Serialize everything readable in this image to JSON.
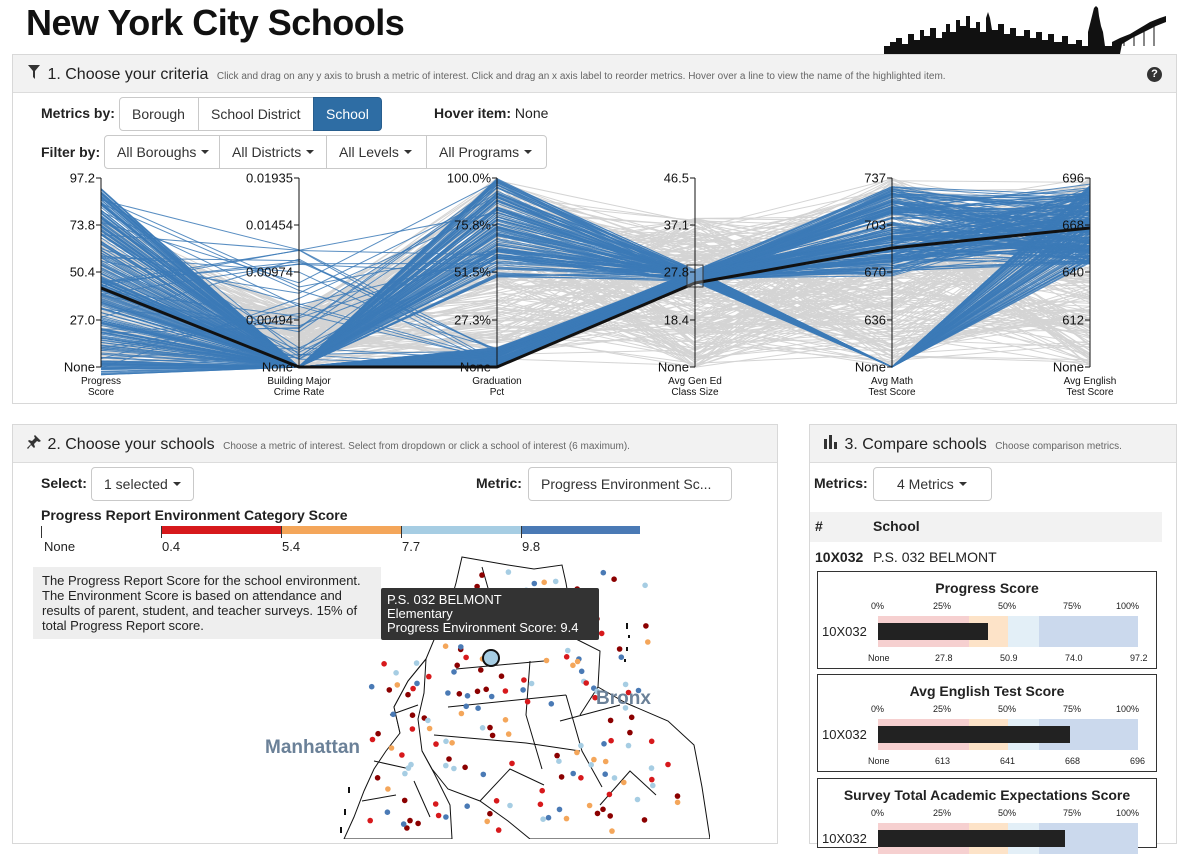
{
  "page_title": "New York City Schools",
  "criteria": {
    "number_title": "1. Choose your criteria",
    "subtitle": "Click and drag on any y axis to brush a metric of interest. Click and drag an x axis label to reorder metrics. Hover over a line to view the name of the highlighted item.",
    "help": "?",
    "metrics_by_label": "Metrics by:",
    "metrics_by_options": [
      "Borough",
      "School District",
      "School"
    ],
    "metrics_by_selected": "School",
    "hover_label": "Hover item:",
    "hover_value": "None",
    "filter_label": "Filter by:",
    "filters": [
      "All Boroughs",
      "All Districts",
      "All Levels",
      "All Programs"
    ],
    "axes": [
      {
        "label1": "Progress",
        "label2": "Score",
        "ticks": [
          "97.2",
          "73.8",
          "50.4",
          "27.0",
          "None"
        ]
      },
      {
        "label1": "Building Major",
        "label2": "Crime Rate",
        "ticks": [
          "0.01935",
          "0.01454",
          "0.00974",
          "0.00494",
          "None"
        ]
      },
      {
        "label1": "Graduation",
        "label2": "Pct",
        "ticks": [
          "100.0%",
          "75.8%",
          "51.5%",
          "27.3%",
          "None"
        ]
      },
      {
        "label1": "Avg Gen Ed",
        "label2": "Class Size",
        "ticks": [
          "46.5",
          "37.1",
          "27.8",
          "18.4",
          "None"
        ]
      },
      {
        "label1": "Avg Math",
        "label2": "Test Score",
        "ticks": [
          "737",
          "703",
          "670",
          "636",
          "None"
        ]
      },
      {
        "label1": "Avg English",
        "label2": "Test Score",
        "ticks": [
          "696",
          "668",
          "640",
          "612",
          "None"
        ]
      }
    ]
  },
  "schools_panel": {
    "number_title": "2. Choose your schools",
    "subtitle": "Choose a metric of interest. Select from dropdown or click a school of interest (6 maximum).",
    "select_label": "Select:",
    "select_value": "1 selected",
    "metric_label": "Metric:",
    "metric_value": "Progress Environment Sc...",
    "legend_title": "Progress Report Environment Category Score",
    "legend_none": "None",
    "legend_values": [
      "0.4",
      "5.4",
      "7.7",
      "9.8"
    ],
    "legend_colors": [
      "#d7191c",
      "#f4a65a",
      "#a6cde3",
      "#4a7ab5"
    ],
    "description": "The Progress Report Score for the school environment. The Environment Score is based on attendance and results of parent, student, and teacher surveys. 15% of total Progress Report score.",
    "tooltip": {
      "name": "P.S. 032 BELMONT",
      "level": "Elementary",
      "metric": "Progress Environment Score: 9.4"
    },
    "map_labels": {
      "bronx": "Bronx",
      "manhattan": "Manhattan"
    }
  },
  "compare_panel": {
    "number_title": "3. Compare schools",
    "subtitle": "Choose comparison metrics.",
    "metrics_label": "Metrics:",
    "metrics_value": "4 Metrics",
    "col_hash": "#",
    "col_school": "School",
    "row_id": "10X032",
    "row_name": "P.S. 032 BELMONT",
    "cards": [
      {
        "title": "Progress Score",
        "row_label": "10X032",
        "pct_labels": [
          "0%",
          "25%",
          "50%",
          "75%",
          "100%"
        ],
        "value_labels": [
          "None",
          "27.8",
          "50.9",
          "74.0",
          "97.2"
        ],
        "value": 0.423
      },
      {
        "title": "Avg English Test Score",
        "row_label": "10X032",
        "pct_labels": [
          "0%",
          "25%",
          "50%",
          "75%",
          "100%"
        ],
        "value_labels": [
          "None",
          "613",
          "641",
          "668",
          "696"
        ],
        "value": 0.74
      },
      {
        "title": "Survey Total Academic Expectations Score",
        "row_label": "10X032",
        "pct_labels": [
          "0%",
          "25%",
          "50%",
          "75%",
          "100%"
        ],
        "value_labels": [],
        "value": 0.72
      }
    ]
  }
}
